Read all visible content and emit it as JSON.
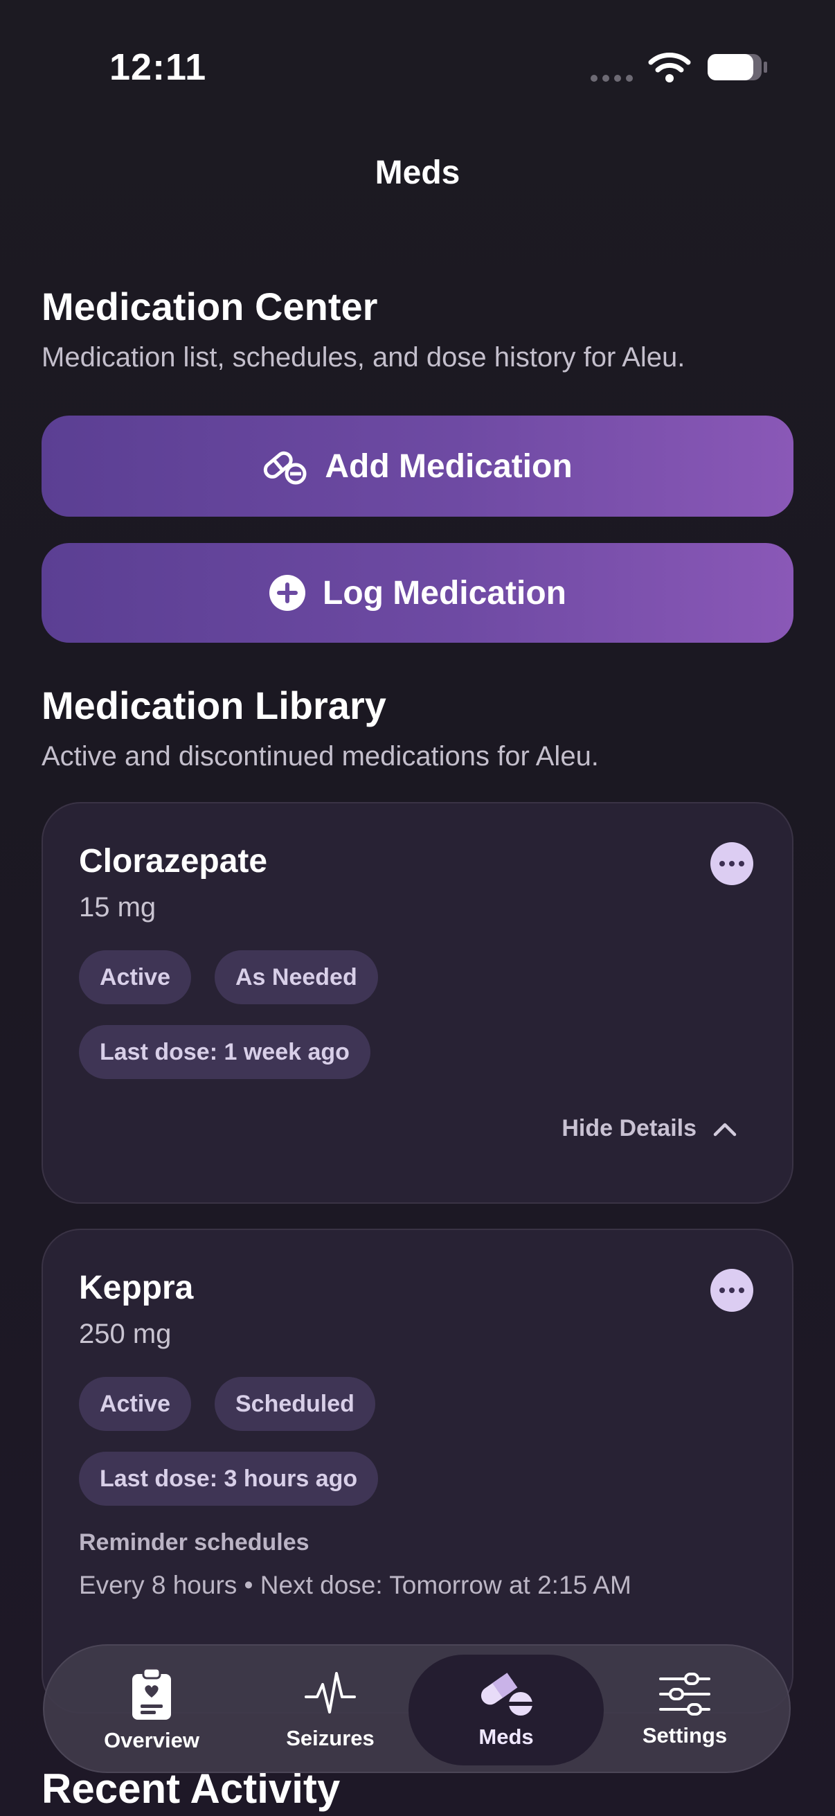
{
  "status": {
    "time": "12:11"
  },
  "nav": {
    "title": "Meds"
  },
  "center": {
    "title": "Medication Center",
    "subtitle": "Medication list, schedules, and dose history for Aleu.",
    "add_label": "Add Medication",
    "log_label": "Log Medication"
  },
  "library": {
    "title": "Medication Library",
    "subtitle": "Active and discontinued medications for Aleu.",
    "meds": [
      {
        "name": "Clorazepate",
        "dose": "15 mg",
        "chips": [
          "Active",
          "As Needed"
        ],
        "last_dose": "Last dose: 1 week ago",
        "toggle_label": "Hide Details"
      },
      {
        "name": "Keppra",
        "dose": "250 mg",
        "chips": [
          "Active",
          "Scheduled"
        ],
        "last_dose": "Last dose: 3 hours ago",
        "reminder_label": "Reminder schedules",
        "reminder_text": "Every 8 hours • Next dose: Tomorrow at 2:15 AM"
      }
    ]
  },
  "recent": {
    "title": "Recent Activity"
  },
  "tabs": [
    {
      "label": "Overview",
      "icon": "clipboard-heart-icon"
    },
    {
      "label": "Seizures",
      "icon": "waveform-icon"
    },
    {
      "label": "Meds",
      "icon": "pills-icon",
      "active": true
    },
    {
      "label": "Settings",
      "icon": "sliders-icon"
    }
  ],
  "colors": {
    "accent": "#7a52ad",
    "chip": "#3f3555",
    "card": "#282234",
    "background": "#1c1a22"
  }
}
